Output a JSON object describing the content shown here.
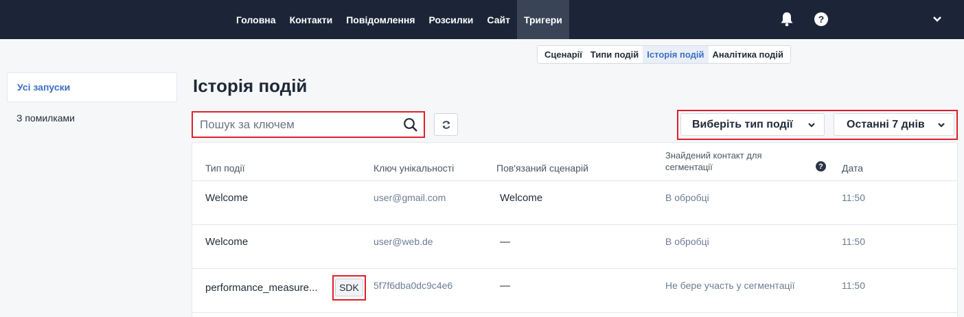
{
  "nav": {
    "items": [
      {
        "label": "Головна"
      },
      {
        "label": "Контакти"
      },
      {
        "label": "Повідомлення"
      },
      {
        "label": "Розсилки"
      },
      {
        "label": "Сайт"
      },
      {
        "label": "Тригери",
        "active": true
      }
    ],
    "icons": [
      "bell-icon",
      "help-icon",
      "chevron-down-icon"
    ],
    "help_glyph": "?"
  },
  "subtabs": [
    {
      "label": "Сценарії"
    },
    {
      "label": "Типи подій"
    },
    {
      "label": "Історія подій",
      "active": true
    },
    {
      "label": "Аналітика подій"
    }
  ],
  "sidebar": {
    "items": [
      {
        "label": "Усі запуски",
        "active": true
      },
      {
        "label": "З помилками"
      }
    ]
  },
  "page_title": "Історія подій",
  "search": {
    "placeholder": "Пошук за ключем",
    "value": ""
  },
  "filters": {
    "event_type": "Виберіть тип події",
    "period": "Останні 7 днів"
  },
  "table": {
    "headers": {
      "event_type": "Тип події",
      "unique_key": "Ключ унікальності",
      "scenario": "Пов'язаний сценарій",
      "contact_line1": "Знайдений контакт для",
      "contact_line2": "сегментації",
      "date": "Дата",
      "help_glyph": "?"
    },
    "rows": [
      {
        "event_type": "Welcome",
        "key": "user@gmail.com",
        "scenario": "Welcome",
        "contact": "В обробці",
        "date": "11:50"
      },
      {
        "event_type": "Welcome",
        "key": "user@web.de",
        "scenario": "—",
        "contact": "В обробці",
        "date": "11:50"
      },
      {
        "event_type": "performance_measure...",
        "badge": "SDK",
        "key": "5f7f6dba0dc9c4e6",
        "scenario": "—",
        "contact": "Не бере участь у сегментації",
        "date": "11:50"
      }
    ]
  },
  "colors": {
    "nav_bg": "#1c2538",
    "accent": "#3b6fc4",
    "highlight": "#e11d2a"
  }
}
